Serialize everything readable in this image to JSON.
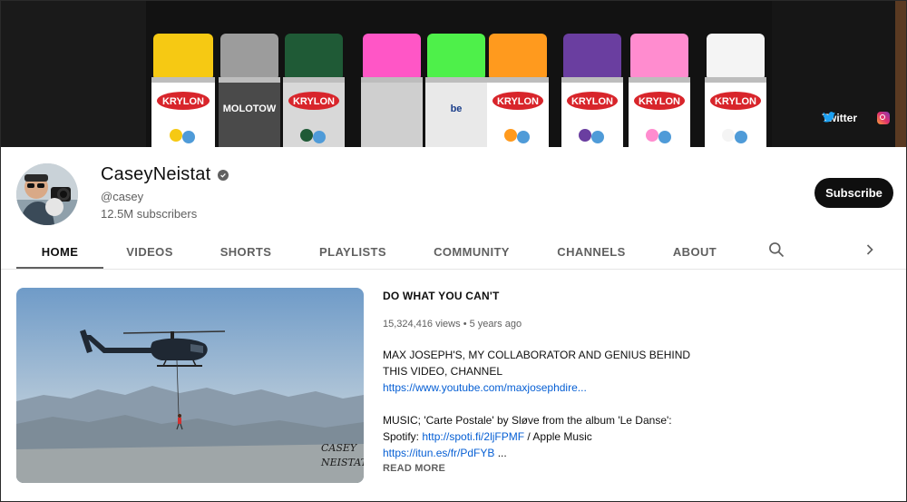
{
  "banner": {
    "cans": [
      {
        "cap": "#f6c913",
        "body": "#ffffff",
        "label": "KRYLON"
      },
      {
        "cap": "#9c9c9c",
        "body": "#4a4a4a",
        "label": "MOLOTOW"
      },
      {
        "cap": "#1f5a36",
        "body": "#d8d8d8",
        "label": "KRYLON"
      },
      {
        "cap": "#ff56c6",
        "body": "#cfcfcf",
        "label": ""
      },
      {
        "cap": "#4ef04a",
        "body": "#e9e9e9",
        "label": "be"
      },
      {
        "cap": "#ff9a1e",
        "body": "#ffffff",
        "label": "KRYLON"
      },
      {
        "cap": "#6a3ea0",
        "body": "#ffffff",
        "label": "KRYLON"
      },
      {
        "cap": "#ff8ccf",
        "body": "#ffffff",
        "label": "KRYLON"
      },
      {
        "cap": "#f4f4f4",
        "body": "#ffffff",
        "label": "KRYLON"
      }
    ],
    "links": [
      {
        "label": "Twitter",
        "icon": "twitter-icon"
      },
      {
        "label": "",
        "icon": "instagram-icon"
      }
    ]
  },
  "channel": {
    "name": "CaseyNeistat",
    "handle": "@casey",
    "subscribers": "12.5M subscribers",
    "subscribe_label": "Subscribe"
  },
  "tabs": [
    {
      "label": "HOME",
      "active": true
    },
    {
      "label": "VIDEOS",
      "active": false
    },
    {
      "label": "SHORTS",
      "active": false
    },
    {
      "label": "PLAYLISTS",
      "active": false
    },
    {
      "label": "COMMUNITY",
      "active": false
    },
    {
      "label": "CHANNELS",
      "active": false
    },
    {
      "label": "ABOUT",
      "active": false
    }
  ],
  "featured": {
    "title": "DO WHAT YOU CAN'T",
    "views": "15,324,416 views",
    "separator": "•",
    "age": "5 years ago",
    "description": {
      "line1": "MAX JOSEPH'S, MY COLLABORATOR AND GENIUS BEHIND",
      "line2": "THIS VIDEO, CHANNEL",
      "link1": "https://www.youtube.com/maxjosephdire...",
      "line4": "MUSIC; 'Carte Postale' by Sløve from the album 'Le Danse':",
      "line5_prefix": "Spotify: ",
      "link2": "http://spoti.fi/2ljFPMF",
      "line5_suffix": " / Apple Music",
      "link3": "https://itun.es/fr/PdFYB",
      "line6_suffix": " ..."
    },
    "read_more": "READ MORE",
    "thumbnail_signature": "CASEY NEISTAT"
  },
  "colors": {
    "accent": "#0f0f0f",
    "link": "#065fd4",
    "muted": "#606060"
  }
}
